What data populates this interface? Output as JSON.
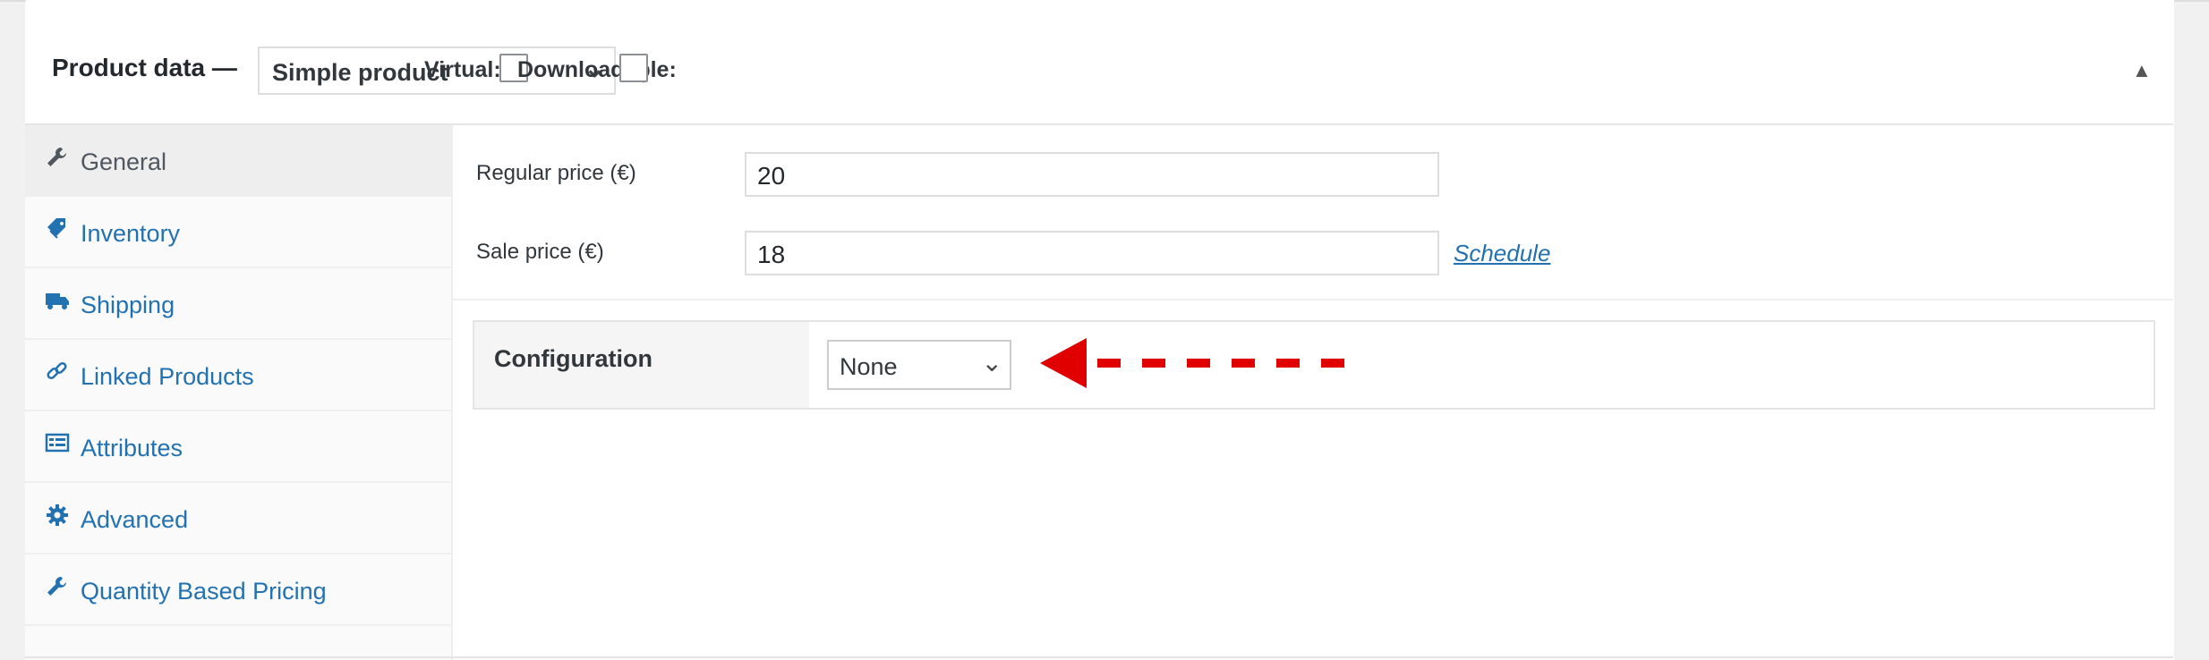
{
  "header": {
    "title": "Product data —",
    "product_type": "Simple product",
    "virtual_label": "Virtual:",
    "downloadable_label": "Downloadable:",
    "virtual_checked": false,
    "downloadable_checked": false,
    "collapse_icon": "triangle-up-icon"
  },
  "sidebar": {
    "items": [
      {
        "label": "General",
        "icon": "wrench-icon",
        "active": true
      },
      {
        "label": "Inventory",
        "icon": "tag-icon",
        "active": false
      },
      {
        "label": "Shipping",
        "icon": "truck-icon",
        "active": false
      },
      {
        "label": "Linked Products",
        "icon": "link-icon",
        "active": false
      },
      {
        "label": "Attributes",
        "icon": "list-card-icon",
        "active": false
      },
      {
        "label": "Advanced",
        "icon": "gear-icon",
        "active": false
      },
      {
        "label": "Quantity Based Pricing",
        "icon": "wrench-icon",
        "active": false
      }
    ]
  },
  "pricing": {
    "regular_label": "Regular price (€)",
    "regular_value": "20",
    "sale_label": "Sale price (€)",
    "sale_value": "18",
    "schedule_link": "Schedule"
  },
  "configuration": {
    "label": "Configuration",
    "selected": "None"
  },
  "colors": {
    "link": "#2271b1",
    "arrow": "#e00000",
    "active_tab_bg": "#eeeeee"
  }
}
